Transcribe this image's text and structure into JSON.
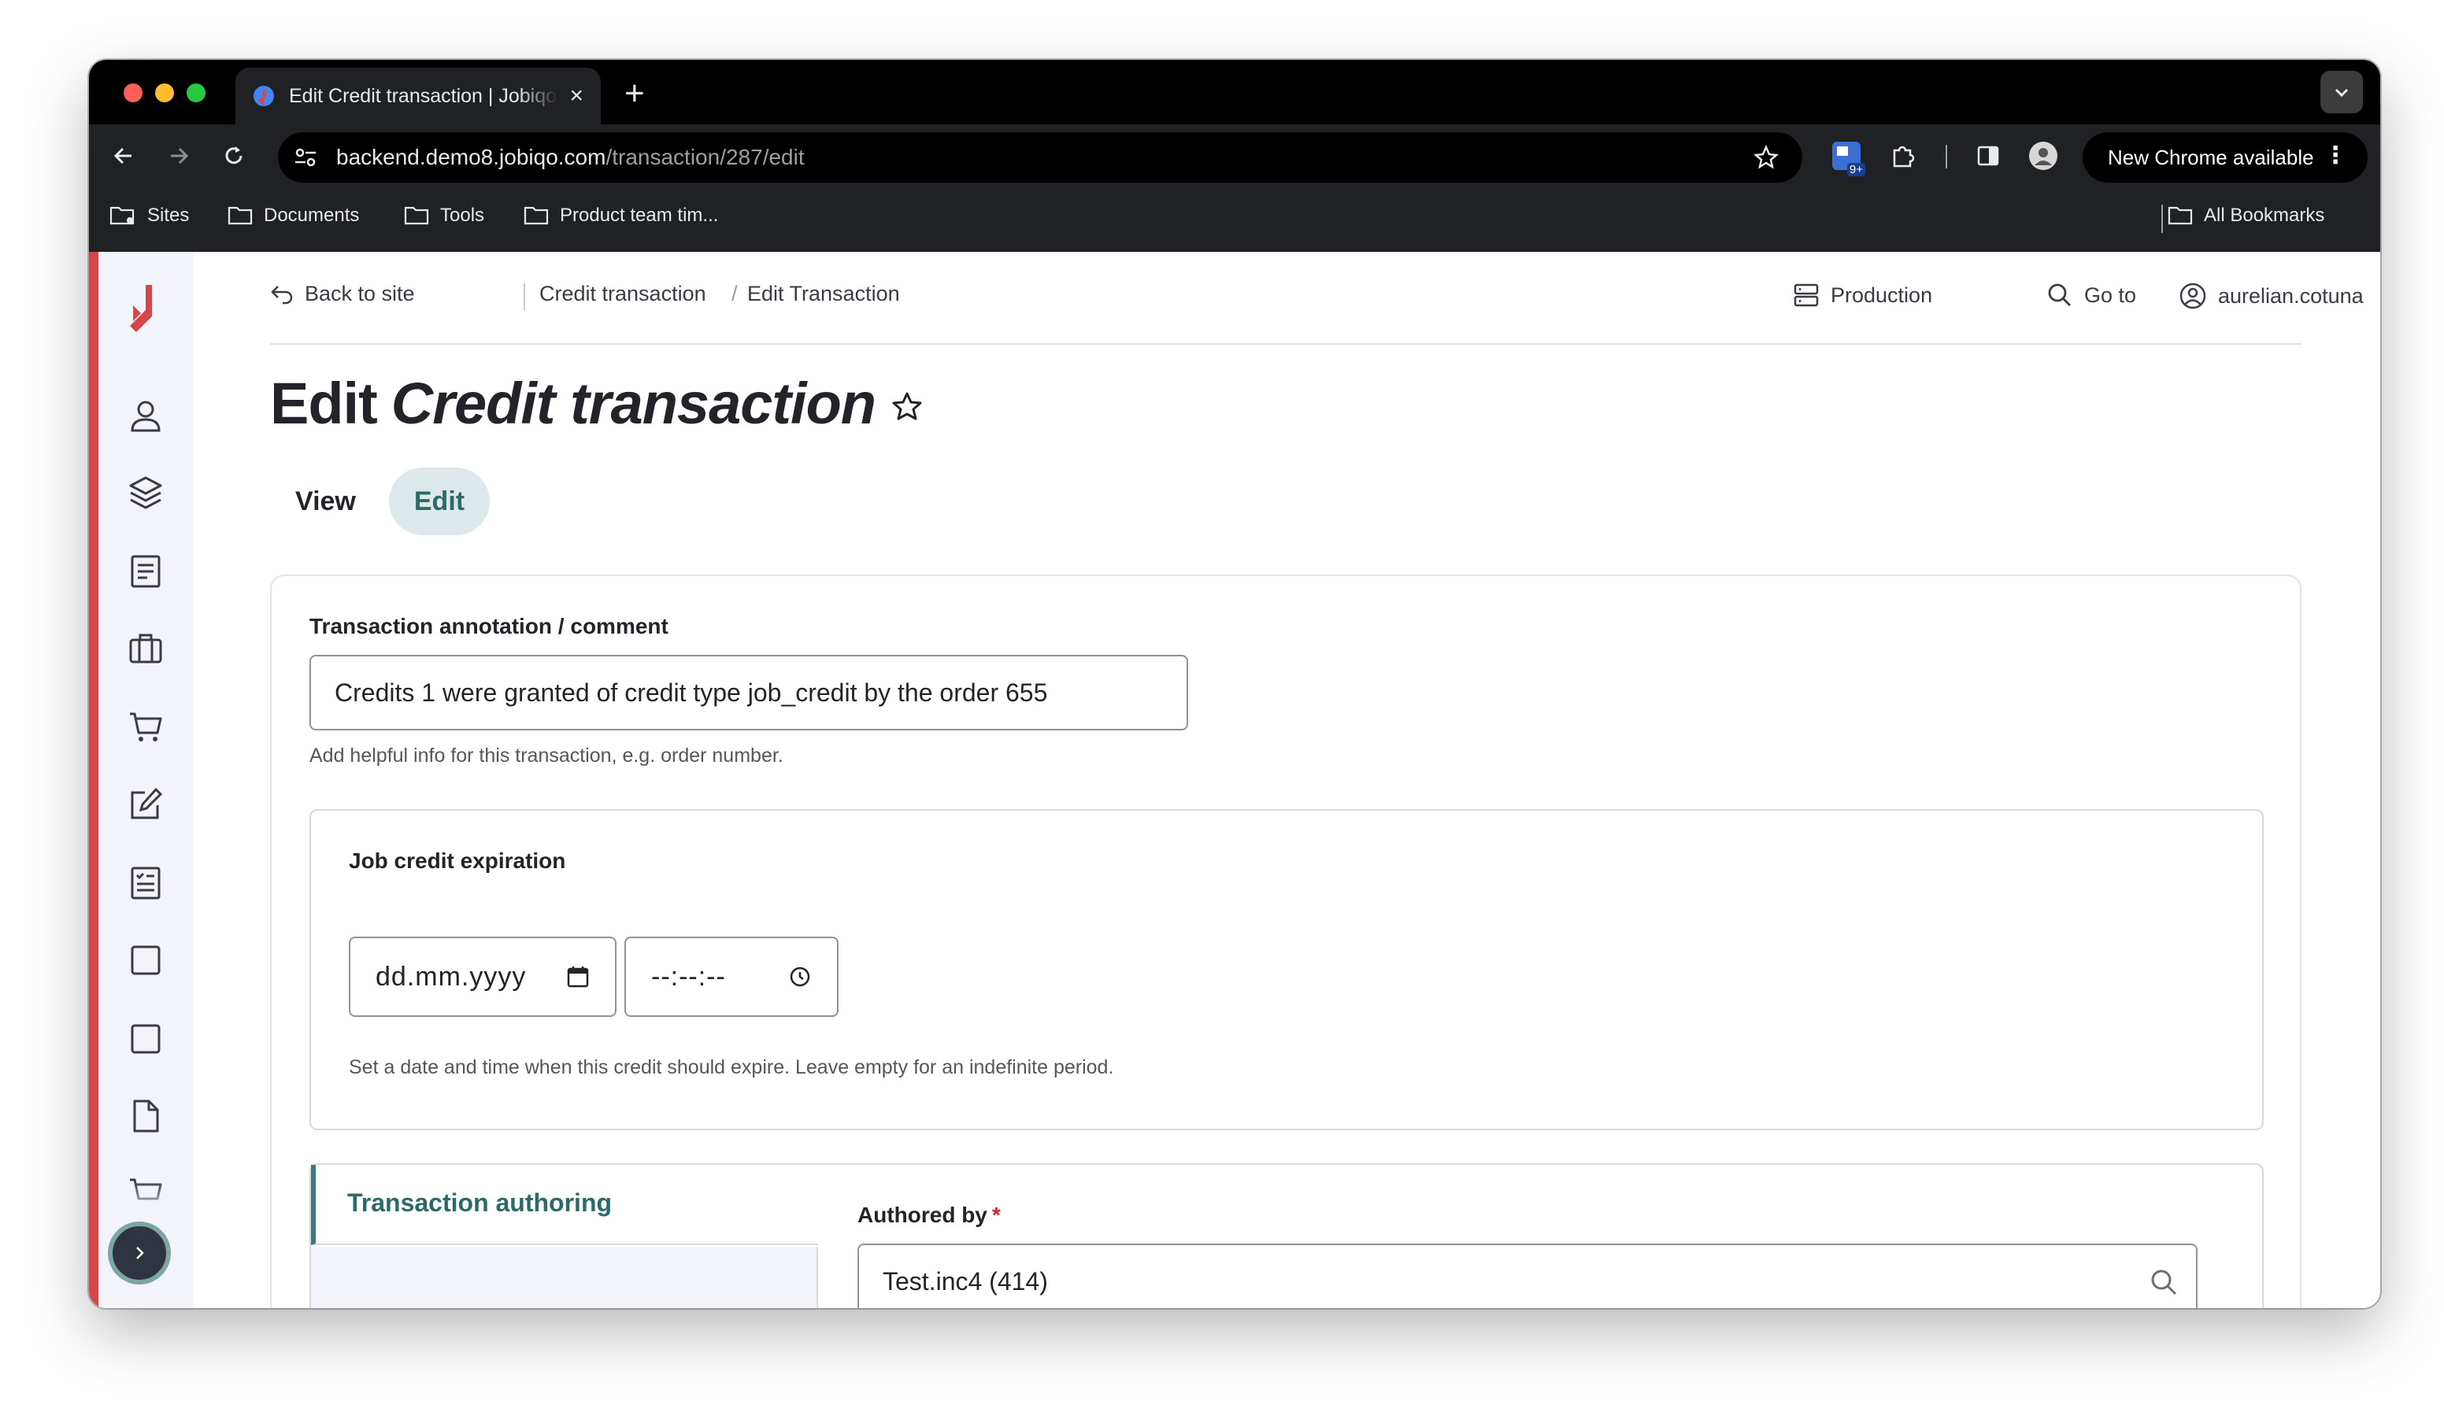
{
  "browser": {
    "tab_title": "Edit Credit transaction | Jobiqo",
    "url_host": "backend.demo8.jobiqo.com",
    "url_path": "/transaction/287/edit",
    "extension_badge": "9+",
    "update_label": "New Chrome available",
    "bookmarks": [
      "Sites",
      "Documents",
      "Tools",
      "Product team tim..."
    ],
    "all_bookmarks_label": "All Bookmarks"
  },
  "topbar": {
    "back_label": "Back to site",
    "breadcrumb": [
      "Credit transaction",
      "Edit Transaction"
    ],
    "breadcrumb_sep": "/",
    "environment_label": "Production",
    "goto_label": "Go to",
    "user_label": "aurelian.cotuna"
  },
  "page": {
    "title_prefix": "Edit",
    "title_entity": "Credit transaction",
    "tabs": [
      "View",
      "Edit"
    ],
    "active_tab": "Edit"
  },
  "form": {
    "annotation_label": "Transaction annotation / comment",
    "annotation_value": "Credits 1 were granted of credit type job_credit by the order 655",
    "annotation_help": "Add helpful info for this transaction, e.g. order number.",
    "expiration_legend": "Job credit expiration",
    "date_placeholder": "dd.mm.yyyy",
    "time_placeholder": "--:--:--",
    "expiration_help": "Set a date and time when this credit should expire. Leave empty for an indefinite period.",
    "authoring_tab": "Transaction authoring",
    "authored_by_label": "Authored by",
    "required_mark": "*",
    "authored_by_value": "Test.inc4 (414)"
  },
  "colors": {
    "accent_red": "#d64648",
    "active_tab_bg": "#dce8ea",
    "active_tab_text": "#2c6a68"
  }
}
